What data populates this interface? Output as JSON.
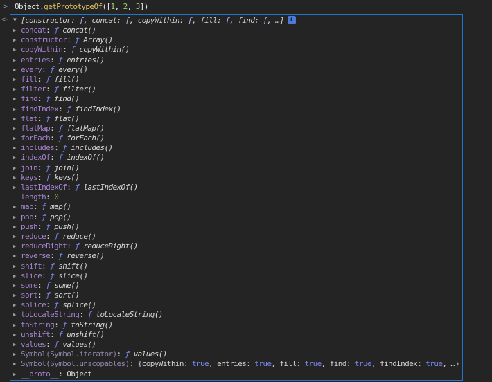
{
  "colors": {
    "background": "#242424",
    "focus_border_blue": "#2076c7",
    "default_text": "#e6e6e6",
    "method_yellow": "#e0c261",
    "number_green": "#9ccc65",
    "property_purple": "#a882d4",
    "symbol_property_dim": "#9187ab",
    "function_symbol_blue": "#7a85ee",
    "info_badge_blue": "#4a7bd8",
    "prompt_gray": "#8c9196"
  },
  "input": {
    "prompt": ">",
    "tokens": [
      {
        "text": "Object.",
        "type": "plain"
      },
      {
        "text": "getPrototypeOf",
        "type": "method"
      },
      {
        "text": "([",
        "type": "plain"
      },
      {
        "text": "1",
        "type": "number"
      },
      {
        "text": ", ",
        "type": "plain"
      },
      {
        "text": "2",
        "type": "number"
      },
      {
        "text": ", ",
        "type": "plain"
      },
      {
        "text": "3",
        "type": "number"
      },
      {
        "text": "])",
        "type": "plain"
      }
    ]
  },
  "result": {
    "return_arrow": "<·",
    "expander_open": "▼",
    "expander_closed": "▶",
    "separator": ": ",
    "fn_symbol": "ƒ",
    "preview": {
      "open": "[",
      "keys": [
        "constructor",
        "concat",
        "copyWithin",
        "fill",
        "find"
      ],
      "ellipsis": "…",
      "close": "]"
    },
    "info_badge": "i",
    "properties": [
      {
        "name": "concat",
        "kind": "function",
        "value": "concat()"
      },
      {
        "name": "constructor",
        "kind": "function",
        "value": "Array()"
      },
      {
        "name": "copyWithin",
        "kind": "function",
        "value": "copyWithin()"
      },
      {
        "name": "entries",
        "kind": "function",
        "value": "entries()"
      },
      {
        "name": "every",
        "kind": "function",
        "value": "every()"
      },
      {
        "name": "fill",
        "kind": "function",
        "value": "fill()"
      },
      {
        "name": "filter",
        "kind": "function",
        "value": "filter()"
      },
      {
        "name": "find",
        "kind": "function",
        "value": "find()"
      },
      {
        "name": "findIndex",
        "kind": "function",
        "value": "findIndex()"
      },
      {
        "name": "flat",
        "kind": "function",
        "value": "flat()"
      },
      {
        "name": "flatMap",
        "kind": "function",
        "value": "flatMap()"
      },
      {
        "name": "forEach",
        "kind": "function",
        "value": "forEach()"
      },
      {
        "name": "includes",
        "kind": "function",
        "value": "includes()"
      },
      {
        "name": "indexOf",
        "kind": "function",
        "value": "indexOf()"
      },
      {
        "name": "join",
        "kind": "function",
        "value": "join()"
      },
      {
        "name": "keys",
        "kind": "function",
        "value": "keys()"
      },
      {
        "name": "lastIndexOf",
        "kind": "function",
        "value": "lastIndexOf()"
      },
      {
        "name": "length",
        "kind": "number",
        "value": "0",
        "expandable": false
      },
      {
        "name": "map",
        "kind": "function",
        "value": "map()"
      },
      {
        "name": "pop",
        "kind": "function",
        "value": "pop()"
      },
      {
        "name": "push",
        "kind": "function",
        "value": "push()"
      },
      {
        "name": "reduce",
        "kind": "function",
        "value": "reduce()"
      },
      {
        "name": "reduceRight",
        "kind": "function",
        "value": "reduceRight()"
      },
      {
        "name": "reverse",
        "kind": "function",
        "value": "reverse()"
      },
      {
        "name": "shift",
        "kind": "function",
        "value": "shift()"
      },
      {
        "name": "slice",
        "kind": "function",
        "value": "slice()"
      },
      {
        "name": "some",
        "kind": "function",
        "value": "some()"
      },
      {
        "name": "sort",
        "kind": "function",
        "value": "sort()"
      },
      {
        "name": "splice",
        "kind": "function",
        "value": "splice()"
      },
      {
        "name": "toLocaleString",
        "kind": "function",
        "value": "toLocaleString()"
      },
      {
        "name": "toString",
        "kind": "function",
        "value": "toString()"
      },
      {
        "name": "unshift",
        "kind": "function",
        "value": "unshift()"
      },
      {
        "name": "values",
        "kind": "function",
        "value": "values()"
      },
      {
        "name": "Symbol(Symbol.iterator)",
        "kind": "function",
        "value": "values()",
        "name_style": "symbol"
      },
      {
        "name": "Symbol(Symbol.unscopables)",
        "kind": "object_preview",
        "name_style": "symbol",
        "preview": {
          "open": "{",
          "entries": [
            {
              "key": "copyWithin",
              "value": "true"
            },
            {
              "key": "entries",
              "value": "true"
            },
            {
              "key": "fill",
              "value": "true"
            },
            {
              "key": "find",
              "value": "true"
            },
            {
              "key": "findIndex",
              "value": "true"
            }
          ],
          "ellipsis": "…",
          "close": "}"
        }
      },
      {
        "name": "__proto__",
        "kind": "object",
        "value": "Object"
      }
    ]
  }
}
